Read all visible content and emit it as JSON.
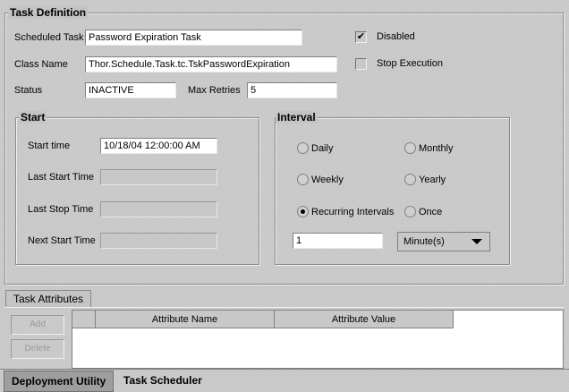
{
  "task_definition": {
    "title": "Task Definition",
    "scheduled_task_label": "Scheduled Task",
    "scheduled_task_value": "Password Expiration Task",
    "class_name_label": "Class Name",
    "class_name_value": "Thor.Schedule.Task.tc.TskPasswordExpiration",
    "status_label": "Status",
    "status_value": "INACTIVE",
    "max_retries_label": "Max Retries",
    "max_retries_value": "5",
    "disabled_label": "Disabled",
    "disabled_checked": true,
    "disabled_mark": "✔",
    "stop_execution_label": "Stop Execution",
    "stop_execution_checked": false
  },
  "start": {
    "title": "Start",
    "start_time_label": "Start time",
    "start_time_value": "10/18/04 12:00:00 AM",
    "last_start_label": "Last Start Time",
    "last_start_value": "",
    "last_stop_label": "Last Stop Time",
    "last_stop_value": "",
    "next_start_label": "Next Start Time",
    "next_start_value": ""
  },
  "interval": {
    "title": "Interval",
    "daily": "Daily",
    "monthly": "Monthly",
    "weekly": "Weekly",
    "yearly": "Yearly",
    "recurring": "Recurring Intervals",
    "once": "Once",
    "selected": "recurring",
    "count_value": "1",
    "unit_value": "Minute(s)"
  },
  "attributes": {
    "tab_label": "Task Attributes",
    "add_label": "Add",
    "delete_label": "Delete",
    "col_name": "Attribute Name",
    "col_value": "Attribute Value"
  },
  "bottom_tabs": {
    "deployment_utility": "Deployment Utility",
    "task_scheduler": "Task Scheduler",
    "active": "deployment_utility"
  },
  "colors": {
    "background": "#c4c4c4",
    "field_background": "#ffffff",
    "active_tab": "#9e9e9e"
  }
}
